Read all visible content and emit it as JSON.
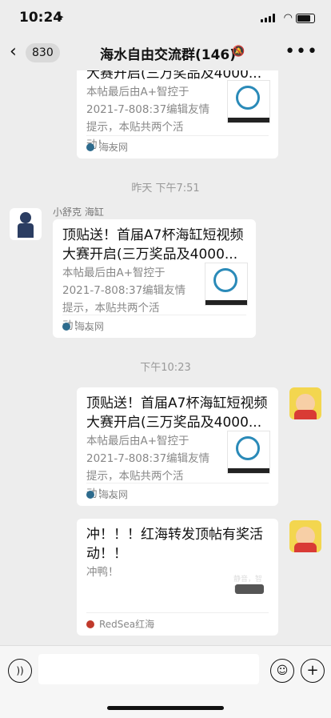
{
  "status": {
    "time": "10:24",
    "loc_icon": "location-arrow"
  },
  "nav": {
    "back_count": "830",
    "title": "海水自由交流群(146)",
    "mute_icon": "bell-slash",
    "more_icon": "ellipsis"
  },
  "messages": {
    "card1": {
      "title_partial": "大赛开启(三万奖品及4000...",
      "desc": "本帖最后由A+智控于2021-7-808:37编辑友情提示，本贴共两个活动！...",
      "source": "海友网"
    },
    "ts1": "昨天 下午7:51",
    "card2": {
      "sender": "小舒克 海缸",
      "title": "顶贴送！首届A7杯海缸短视频大赛开启(三万奖品及4000...",
      "desc": "本帖最后由A+智控于2021-7-808:37编辑友情提示，本贴共两个活动！...",
      "source": "海友网"
    },
    "ts2": "下午10:23",
    "card3": {
      "title": "顶贴送！首届A7杯海缸短视频大赛开启(三万奖品及4000...",
      "desc": "本帖最后由A+智控于2021-7-808:37编辑友情提示，本贴共两个活动！...",
      "source": "海友网"
    },
    "card4": {
      "title": "冲！！！红海转发顶帖有奖活动！！",
      "desc": "冲鸭！",
      "source": "RedSea红海",
      "thumb_text": "静音，智能，强劲"
    }
  }
}
